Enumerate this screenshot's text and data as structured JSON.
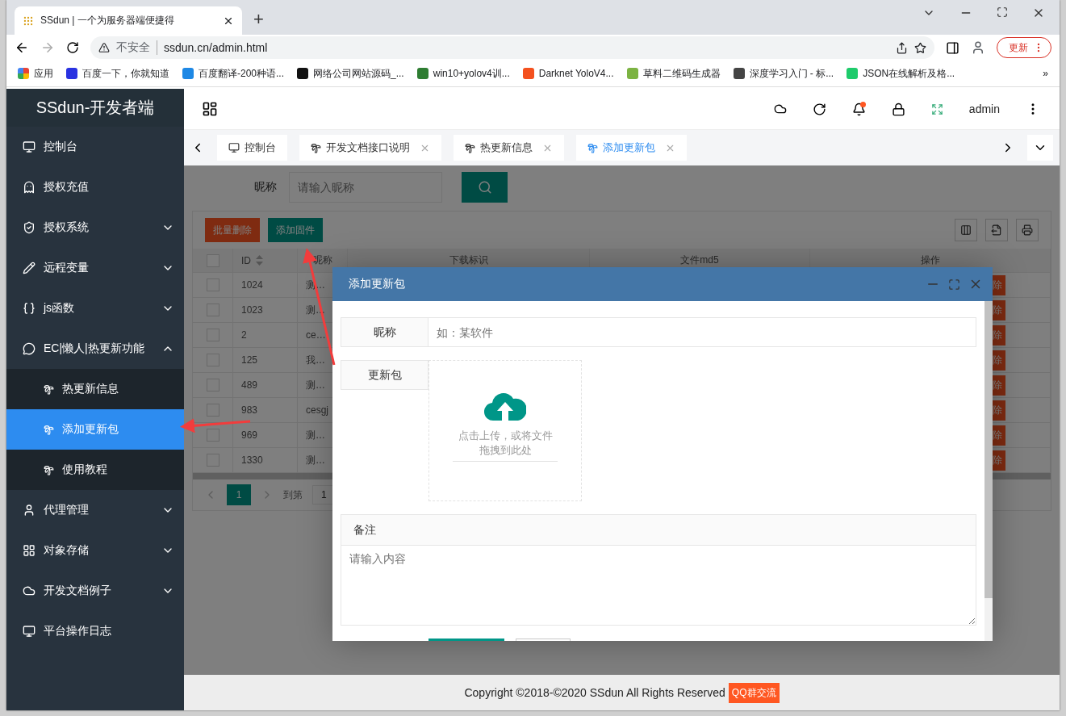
{
  "browser": {
    "tab_title": "SSdun | 一个为服务器端便捷得",
    "new_tab": "+",
    "security": "不安全",
    "url": "ssdun.cn/admin.html",
    "update_button": "更新",
    "bookmarks": [
      {
        "label": "应用"
      },
      {
        "label": "百度一下，你就知道"
      },
      {
        "label": "百度翻译-200种语..."
      },
      {
        "label": "网络公司网站源码_..."
      },
      {
        "label": "win10+yolov4训..."
      },
      {
        "label": "Darknet YoloV4..."
      },
      {
        "label": "草料二维码生成器"
      },
      {
        "label": "深度学习入门 - 标..."
      },
      {
        "label": "JSON在线解析及格..."
      }
    ],
    "more_bookmarks": "»"
  },
  "sidebar": {
    "logo": "SSdun-开发者端",
    "items": [
      {
        "label": "控制台",
        "kind": "link",
        "selected": false
      },
      {
        "label": "授权充值",
        "kind": "link",
        "selected": false
      },
      {
        "label": "授权系统",
        "kind": "group",
        "expanded": false,
        "selected": false
      },
      {
        "label": "远程变量",
        "kind": "group",
        "expanded": false,
        "selected": false
      },
      {
        "label": "js函数",
        "kind": "group",
        "expanded": false,
        "selected": false
      },
      {
        "label": "EC|懒人|热更新功能",
        "kind": "group",
        "expanded": true,
        "selected": false,
        "children": [
          {
            "label": "热更新信息",
            "selected": false
          },
          {
            "label": "添加更新包",
            "selected": true
          },
          {
            "label": "使用教程",
            "selected": false
          }
        ]
      },
      {
        "label": "代理管理",
        "kind": "group",
        "expanded": false,
        "selected": false
      },
      {
        "label": "对象存储",
        "kind": "group",
        "expanded": false,
        "selected": false
      },
      {
        "label": "开发文档例子",
        "kind": "group",
        "expanded": false,
        "selected": false
      },
      {
        "label": "平台操作日志",
        "kind": "link",
        "selected": false
      }
    ]
  },
  "header": {
    "user": "admin",
    "notification": true
  },
  "page_tabs": [
    {
      "label": "控制台",
      "selected": false,
      "closable": false
    },
    {
      "label": "开发文档接口说明",
      "selected": false,
      "closable": true
    },
    {
      "label": "热更新信息",
      "selected": false,
      "closable": true
    },
    {
      "label": "添加更新包",
      "selected": true,
      "closable": true
    }
  ],
  "search": {
    "label": "昵称",
    "placeholder": "请输入昵称"
  },
  "toolbar": [
    {
      "label": "批量删除",
      "kind": "danger"
    },
    {
      "label": "添加固件",
      "kind": "primary"
    }
  ],
  "table": {
    "all_checked": false,
    "columns": [
      "ID",
      "昵称",
      "下载标识",
      "文件md5",
      "操作"
    ],
    "rows": [
      {
        "id": "1024",
        "name": "测…",
        "action": "除",
        "checked": false
      },
      {
        "id": "1023",
        "name": "测…",
        "action": "除",
        "checked": false
      },
      {
        "id": "2",
        "name": "ce…",
        "action": "除",
        "checked": false
      },
      {
        "id": "125",
        "name": "我…",
        "action": "除",
        "checked": false
      },
      {
        "id": "489",
        "name": "测…",
        "action": "除",
        "checked": false
      },
      {
        "id": "983",
        "name": "cesgj",
        "action": "除",
        "checked": false
      },
      {
        "id": "969",
        "name": "测…",
        "action": "除",
        "checked": false
      },
      {
        "id": "1330",
        "name": "测…",
        "action": "除",
        "checked": false
      }
    ]
  },
  "pagination": {
    "page": "1",
    "goto_label": "到第",
    "goto_value": "1"
  },
  "dialog": {
    "title": "添加更新包",
    "fields": [
      {
        "kind": "input",
        "label": "昵称",
        "placeholder": "如：某软件"
      },
      {
        "kind": "upload",
        "label": "更新包",
        "hint": "点击上传，或将文件拖拽到此处"
      },
      {
        "kind": "textarea",
        "label": "备注",
        "placeholder": "请输入内容"
      }
    ]
  },
  "footer": {
    "copyright": "Copyright ©2018-©2020 SSdun All Rights Reserved",
    "badge": "QQ群交流"
  }
}
